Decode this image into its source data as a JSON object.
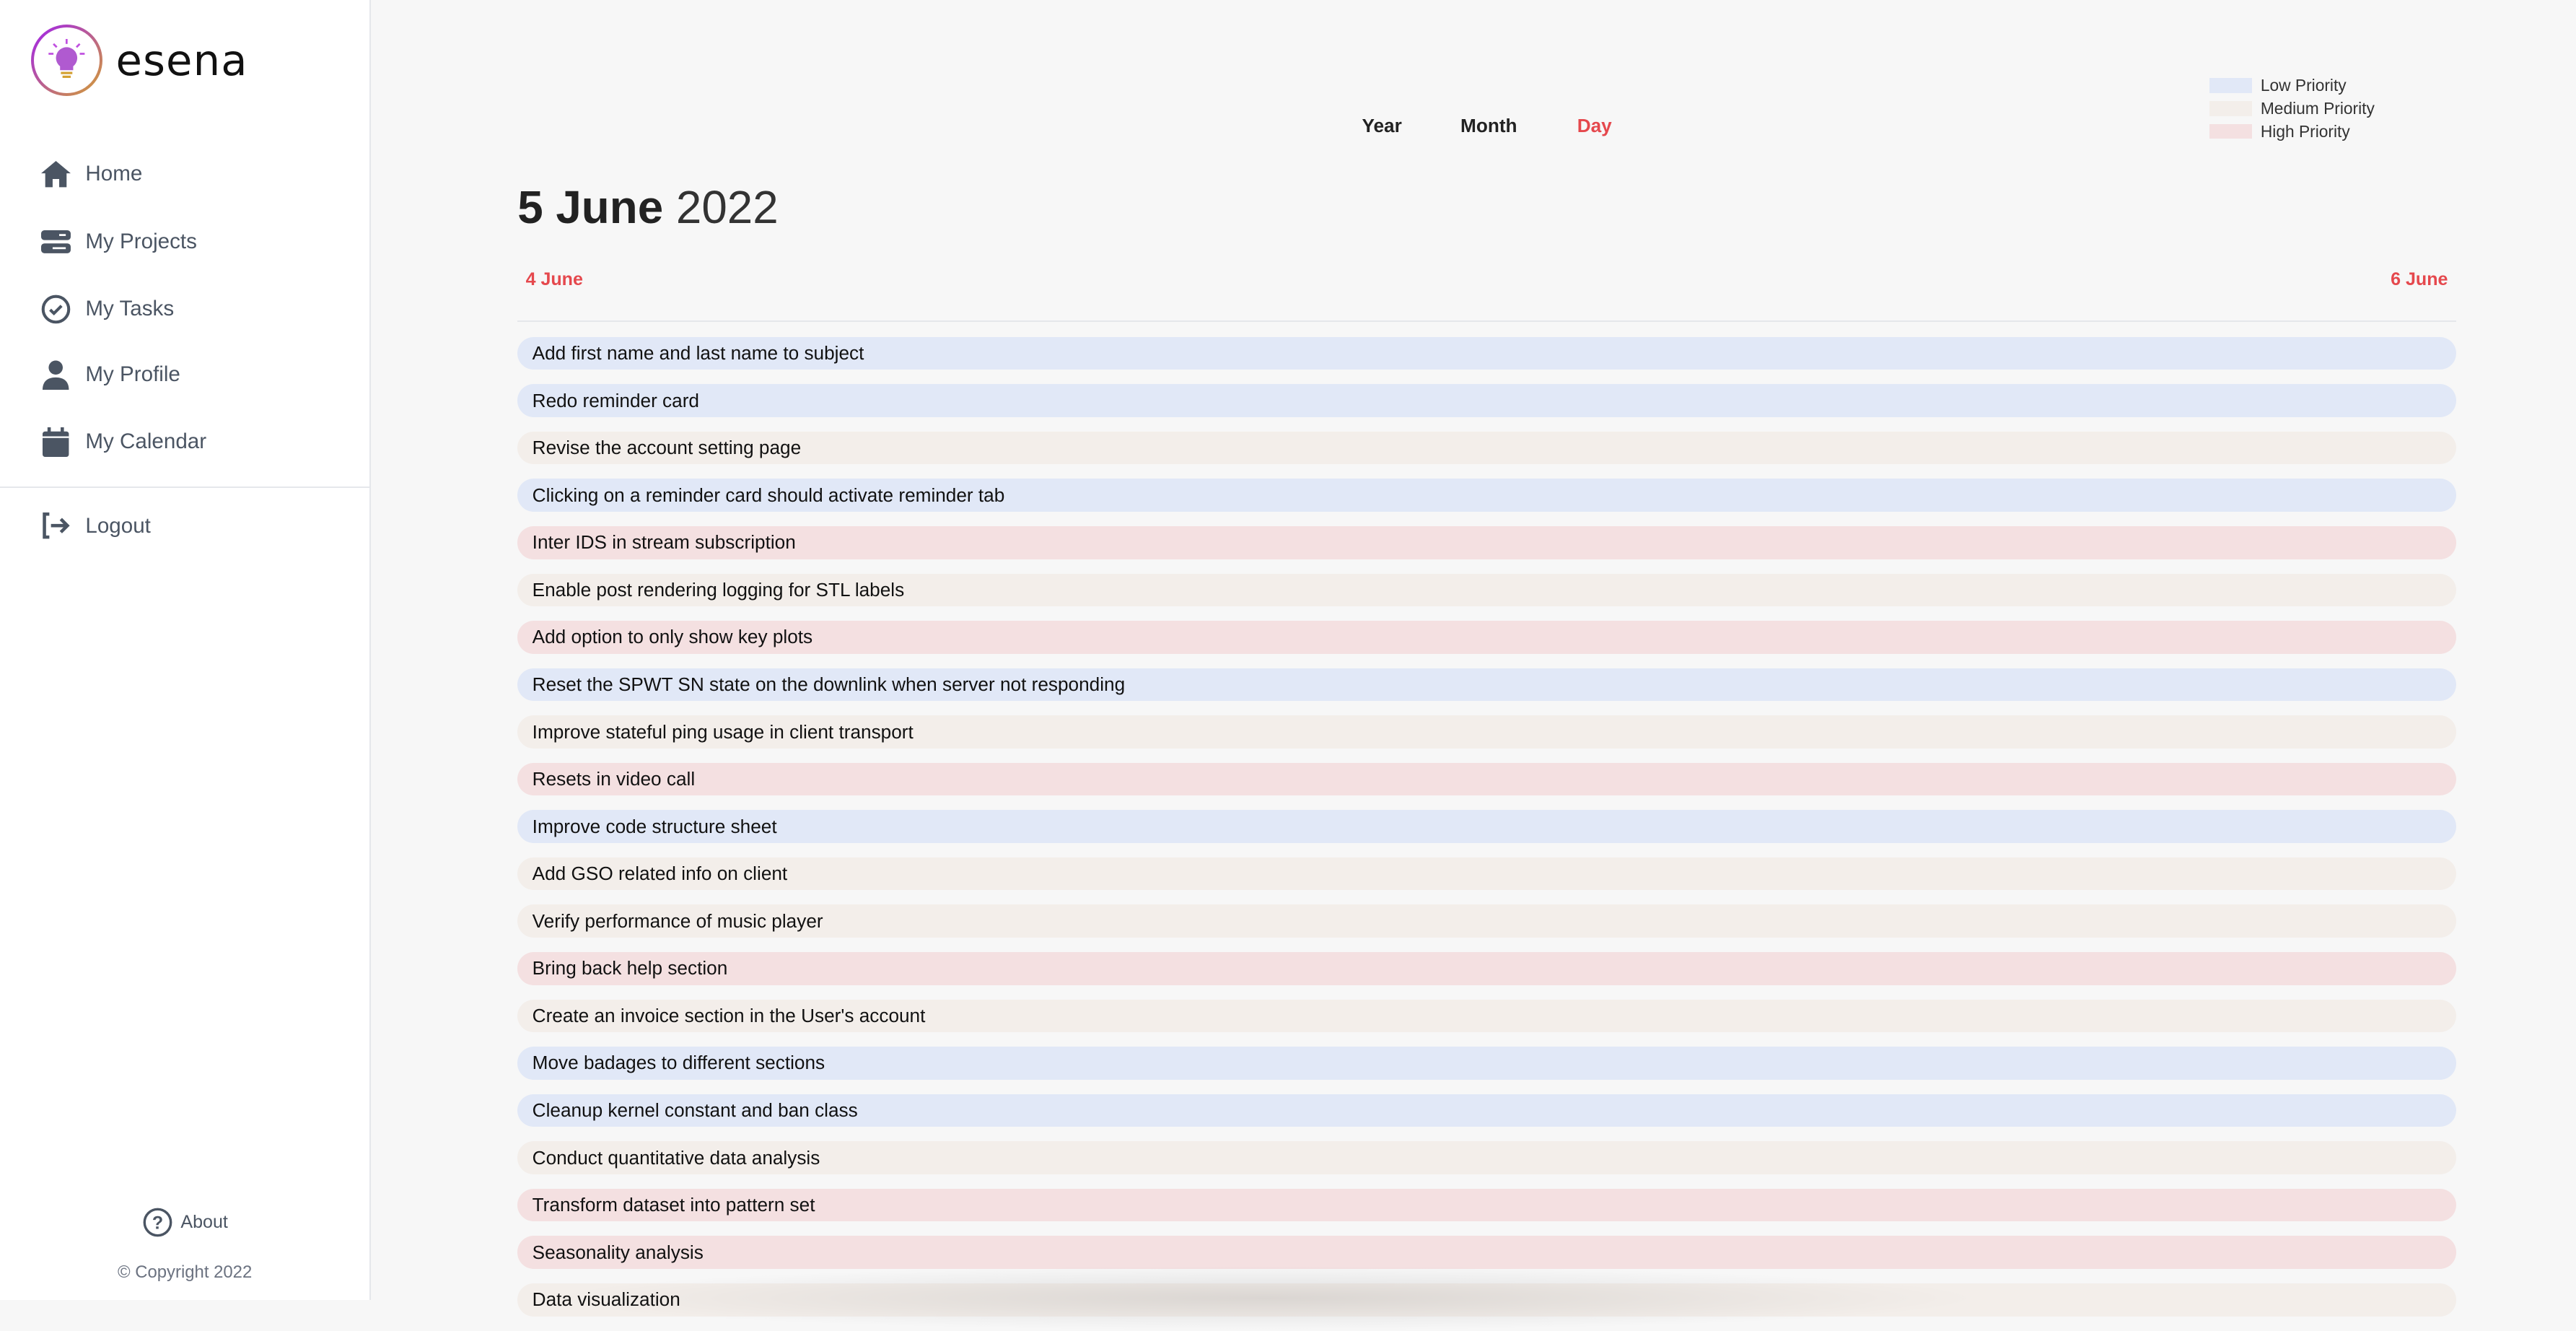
{
  "app": {
    "name": "esena"
  },
  "sidebar": {
    "items": [
      {
        "label": "Home",
        "icon": "home-icon"
      },
      {
        "label": "My Projects",
        "icon": "server-icon"
      },
      {
        "label": "My Tasks",
        "icon": "check-circle-icon"
      },
      {
        "label": "My Profile",
        "icon": "user-icon"
      },
      {
        "label": "My Calendar",
        "icon": "calendar-icon"
      }
    ],
    "logout": "Logout",
    "about": "About",
    "copyright": "© Copyright 2022"
  },
  "view_tabs": [
    {
      "label": "Year"
    },
    {
      "label": "Month"
    },
    {
      "label": "Day",
      "active": true
    }
  ],
  "legend": [
    {
      "label": "Low Priority",
      "color": "#e1e8f7"
    },
    {
      "label": "Medium Priority",
      "color": "#f3eeea"
    },
    {
      "label": "High Priority",
      "color": "#f4e0e1"
    }
  ],
  "date": {
    "day": "5 June",
    "year": "2022",
    "prev": "4 June",
    "next": "6 June"
  },
  "accent": "#e5484d",
  "tasks": [
    {
      "title": "Add first name and last name to subject",
      "priority": "low"
    },
    {
      "title": "Redo reminder card",
      "priority": "low"
    },
    {
      "title": "Revise the account setting page",
      "priority": "medium"
    },
    {
      "title": "Clicking on a reminder card should activate reminder tab",
      "priority": "low"
    },
    {
      "title": "Inter IDS in stream subscription",
      "priority": "high"
    },
    {
      "title": "Enable post rendering logging for STL labels",
      "priority": "medium"
    },
    {
      "title": "Add option to only show key plots",
      "priority": "high"
    },
    {
      "title": "Reset the SPWT SN state on the downlink when server not responding",
      "priority": "low"
    },
    {
      "title": "Improve stateful ping usage in client transport",
      "priority": "medium"
    },
    {
      "title": "Resets in video call",
      "priority": "high"
    },
    {
      "title": "Improve code structure sheet",
      "priority": "low"
    },
    {
      "title": "Add GSO related info on client",
      "priority": "medium"
    },
    {
      "title": "Verify performance of music player",
      "priority": "medium"
    },
    {
      "title": "Bring back help section",
      "priority": "high"
    },
    {
      "title": "Create an invoice section in the User's account",
      "priority": "medium"
    },
    {
      "title": "Move badages to different sections",
      "priority": "low"
    },
    {
      "title": "Cleanup kernel constant and ban class",
      "priority": "low"
    },
    {
      "title": "Conduct quantitative data analysis",
      "priority": "medium"
    },
    {
      "title": "Transform dataset into pattern set",
      "priority": "high"
    },
    {
      "title": "Seasonality analysis",
      "priority": "high"
    },
    {
      "title": "Data visualization",
      "priority": "medium"
    }
  ]
}
